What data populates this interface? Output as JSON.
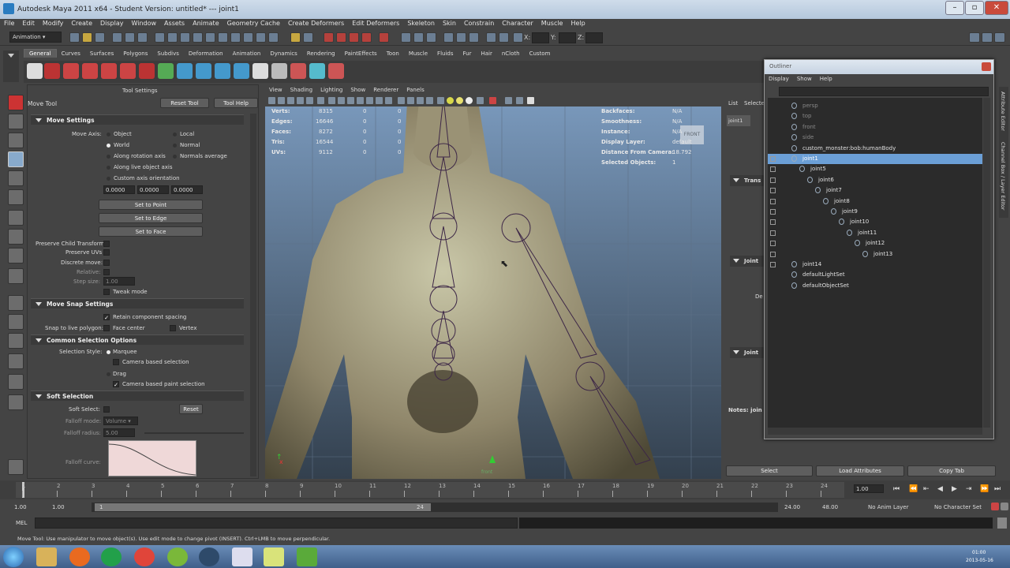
{
  "window": {
    "title": "Autodesk Maya 2011 x64 - Student Version: untitled*    ---    joint1"
  },
  "menubar": [
    "File",
    "Edit",
    "Modify",
    "Create",
    "Display",
    "Window",
    "Assets",
    "Animate",
    "Geometry Cache",
    "Create Deformers",
    "Edit Deformers",
    "Skeleton",
    "Skin",
    "Constrain",
    "Character",
    "Muscle",
    "Help"
  ],
  "status": {
    "mode": "Animation",
    "x_label": "X:",
    "y_label": "Y:",
    "z_label": "Z:"
  },
  "shelf": {
    "tabs": [
      "General",
      "Curves",
      "Surfaces",
      "Polygons",
      "Subdivs",
      "Deformation",
      "Animation",
      "Dynamics",
      "Rendering",
      "PaintEffects",
      "Toon",
      "Muscle",
      "Fluids",
      "Fur",
      "Hair",
      "nCloth",
      "Custom"
    ],
    "active": "General"
  },
  "tool_settings": {
    "title": "Tool Settings",
    "tool_name": "Move Tool",
    "reset_button": "Reset Tool",
    "help_button": "Tool Help",
    "move_settings": {
      "header": "Move Settings",
      "move_axis_label": "Move Axis:",
      "options": [
        "Object",
        "Local",
        "World",
        "Normal",
        "Along rotation axis",
        "Normals average",
        "Along live object axis",
        "Custom axis orientation"
      ],
      "custom_values": [
        "0.0000",
        "0.0000",
        "0.0000"
      ],
      "set_to_point": "Set to Point",
      "set_to_edge": "Set to Edge",
      "set_to_face": "Set to Face",
      "preserve_child": "Preserve Child Transform",
      "preserve_uvs": "Preserve UVs",
      "discrete_move": "Discrete move:",
      "relative": "Relative:",
      "step_size": "Step size:",
      "step_value": "1.00",
      "tweak_mode": "Tweak mode"
    },
    "snap": {
      "header": "Move Snap Settings",
      "retain": "Retain component spacing",
      "snap_live": "Snap to live polygon:",
      "face_center": "Face center",
      "vertex": "Vertex"
    },
    "selection": {
      "header": "Common Selection Options",
      "style_label": "Selection Style:",
      "marquee": "Marquee",
      "camera_based": "Camera based selection",
      "drag": "Drag",
      "camera_paint": "Camera based paint selection"
    },
    "soft": {
      "header": "Soft Selection",
      "soft_select": "Soft Select:",
      "reset": "Reset",
      "falloff_mode": "Falloff mode:",
      "falloff_mode_value": "Volume",
      "falloff_radius": "Falloff radius:",
      "falloff_radius_value": "5.00",
      "falloff_curve": "Falloff curve:"
    }
  },
  "viewport": {
    "menu": [
      "View",
      "Shading",
      "Lighting",
      "Show",
      "Renderer",
      "Panels"
    ],
    "hud_left": [
      {
        "label": "Verts:",
        "v1": "8315",
        "v2": "0",
        "v3": "0"
      },
      {
        "label": "Edges:",
        "v1": "16646",
        "v2": "0",
        "v3": "0"
      },
      {
        "label": "Faces:",
        "v1": "8272",
        "v2": "0",
        "v3": "0"
      },
      {
        "label": "Tris:",
        "v1": "16544",
        "v2": "0",
        "v3": "0"
      },
      {
        "label": "UVs:",
        "v1": "9112",
        "v2": "0",
        "v3": "0"
      }
    ],
    "hud_right": [
      {
        "label": "Backfaces:",
        "value": "N/A"
      },
      {
        "label": "Smoothness:",
        "value": "N/A"
      },
      {
        "label": "Instance:",
        "value": "N/A"
      },
      {
        "label": "Display Layer:",
        "value": "default"
      },
      {
        "label": "Distance From Camera:",
        "value": "18.792"
      },
      {
        "label": "Selected Objects:",
        "value": "1"
      }
    ],
    "view_cube": "FRONT",
    "camera_label": "front"
  },
  "right_panel": {
    "list": "List",
    "selected": "Selecte",
    "tab": "joint1",
    "transform": "Trans",
    "joint": "Joint",
    "de": "De",
    "joint2": "Joint",
    "notes": "Notes: join",
    "select_button": "Select",
    "load_button": "Load Attributes",
    "copy_button": "Copy Tab",
    "side_tabs": [
      "Attribute Editor",
      "Channel Box / Layer Editor"
    ]
  },
  "outliner": {
    "title": "Outliner",
    "menu": [
      "Display",
      "Show",
      "Help"
    ],
    "items": [
      {
        "name": "persp",
        "indent": 0,
        "dim": true
      },
      {
        "name": "top",
        "indent": 0,
        "dim": true
      },
      {
        "name": "front",
        "indent": 0,
        "dim": true
      },
      {
        "name": "side",
        "indent": 0,
        "dim": true
      },
      {
        "name": "custom_monster:bob:humanBody",
        "indent": 0,
        "dim": false
      },
      {
        "name": "joint1",
        "indent": 0,
        "dim": false,
        "selected": true
      },
      {
        "name": "joint5",
        "indent": 1,
        "dim": false
      },
      {
        "name": "joint6",
        "indent": 2,
        "dim": false
      },
      {
        "name": "joint7",
        "indent": 3,
        "dim": false
      },
      {
        "name": "joint8",
        "indent": 4,
        "dim": false
      },
      {
        "name": "joint9",
        "indent": 5,
        "dim": false
      },
      {
        "name": "joint10",
        "indent": 6,
        "dim": false
      },
      {
        "name": "joint11",
        "indent": 7,
        "dim": false
      },
      {
        "name": "joint12",
        "indent": 8,
        "dim": false
      },
      {
        "name": "joint13",
        "indent": 9,
        "dim": false
      },
      {
        "name": "joint14",
        "indent": 0,
        "dim": false
      },
      {
        "name": "defaultLightSet",
        "indent": 0,
        "dim": false
      },
      {
        "name": "defaultObjectSet",
        "indent": 0,
        "dim": false
      }
    ]
  },
  "timeline": {
    "ticks": [
      "1",
      "2",
      "3",
      "4",
      "5",
      "6",
      "7",
      "8",
      "9",
      "10",
      "11",
      "12",
      "13",
      "14",
      "15",
      "16",
      "17",
      "18",
      "19",
      "20",
      "21",
      "22",
      "23",
      "24"
    ],
    "current": "1.00"
  },
  "range": {
    "start": "1.00",
    "start2": "1.00",
    "inner_start": "1",
    "inner_end": "24",
    "end": "24.00",
    "end2": "48.00",
    "anim_layer": "No Anim Layer",
    "character_set": "No Character Set"
  },
  "mel": {
    "label": "MEL"
  },
  "help_line": "Move Tool: Use manipulator to move object(s). Use edit mode to change pivot (INSERT). Ctrl+LMB to move perpendicular.",
  "clock": {
    "time": "01:00",
    "date": "2013-05-16"
  }
}
